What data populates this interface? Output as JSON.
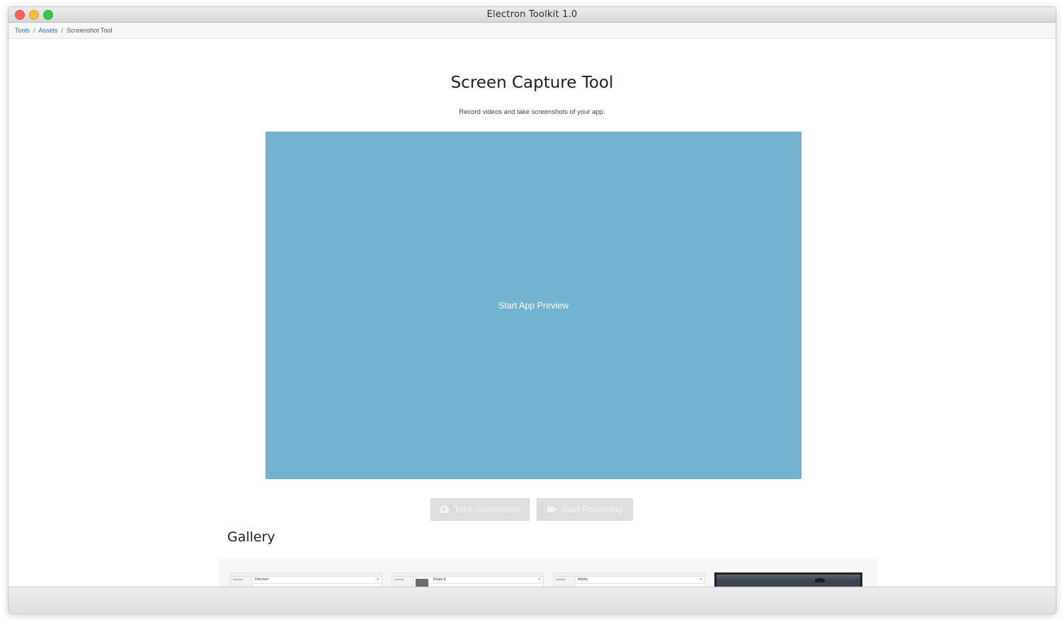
{
  "window": {
    "title": "Electron Toolkit 1.0"
  },
  "breadcrumb": {
    "items": [
      "Tools",
      "Assets"
    ],
    "current": "Screenshot Tool"
  },
  "header": {
    "title": "Screen Capture Tool",
    "subtitle": "Record videos and take screenshots of your app."
  },
  "preview": {
    "label": "Start App Preview",
    "color": "#73b3cf"
  },
  "actions": {
    "screenshot_label": "Take Screenshot",
    "screenshot_icon": "camera-icon",
    "record_label": "Start Recording",
    "record_icon": "video-camera-icon"
  },
  "gallery": {
    "title": "Gallery",
    "thumbnails": [
      {
        "label": "Discover"
      },
      {
        "label": "Route 8"
      },
      {
        "label": "Artists"
      },
      {
        "label": ""
      }
    ]
  }
}
